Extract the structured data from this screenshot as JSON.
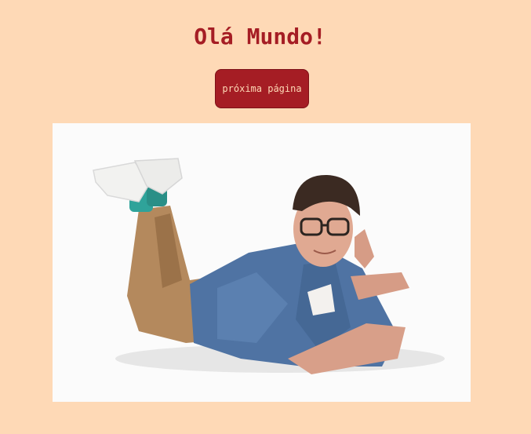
{
  "page": {
    "title": "Olá Mundo!",
    "next_button_label": "próxima página"
  },
  "photo": {
    "subject": "man-lying-on-floor-photo"
  },
  "colors": {
    "background": "#fed9b6",
    "accent": "#a51d24",
    "button_text": "#fed9b6"
  }
}
